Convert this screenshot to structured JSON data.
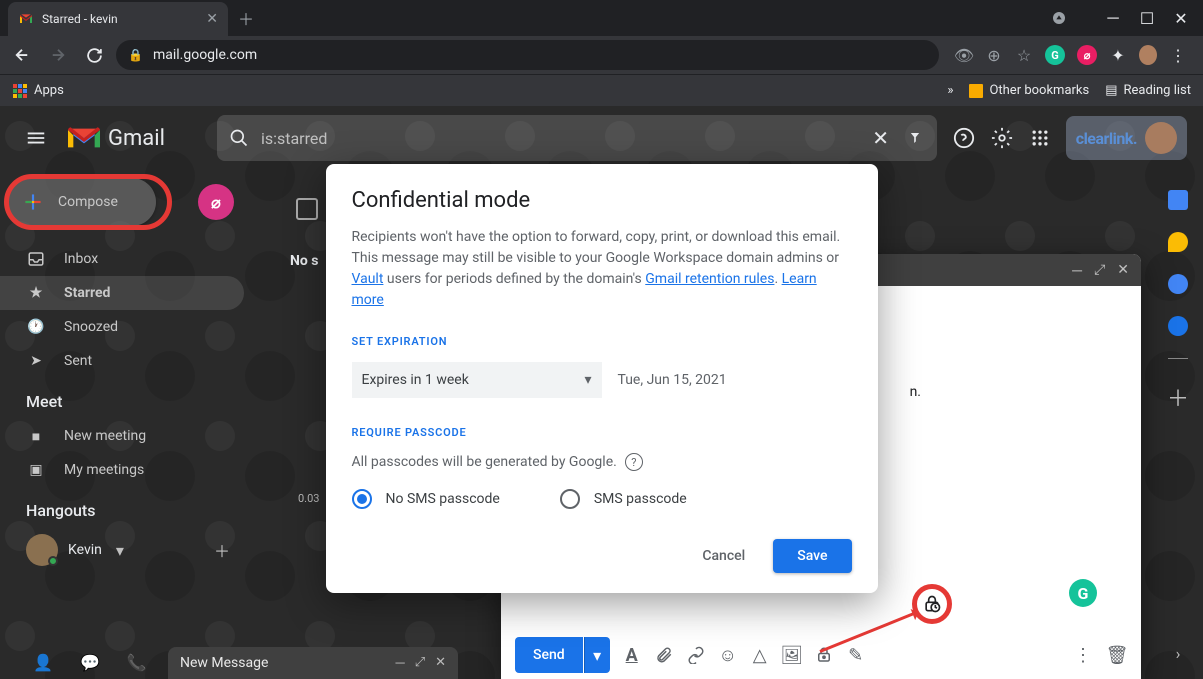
{
  "browser": {
    "tab_title": "Starred - kevin",
    "url": "mail.google.com",
    "bookmarks": {
      "apps": "Apps",
      "other": "Other bookmarks",
      "reading": "Reading list"
    }
  },
  "gmail": {
    "brand": "Gmail",
    "search_value": "is:starred",
    "org": "clearlink.",
    "compose": "Compose",
    "sidebar": {
      "inbox": "Inbox",
      "starred": "Starred",
      "snoozed": "Snoozed",
      "sent": "Sent"
    },
    "meet": {
      "header": "Meet",
      "new": "New meeting",
      "my": "My meetings"
    },
    "hangouts": {
      "header": "Hangouts",
      "user": "Kevin"
    },
    "chat_dock": "New Message",
    "truncated_label": "No s",
    "tiny_number": "0.03"
  },
  "compose_window": {
    "send": "Send",
    "body_hint": "n."
  },
  "modal": {
    "title": "Confidential mode",
    "desc_1": "Recipients won't have the option to forward, copy, print, or download this email. This message may still be visible to your Google Workspace domain admins or ",
    "link_vault": "Vault",
    "desc_2": " users for periods defined by the domain's ",
    "link_retention": "Gmail retention rules",
    "desc_3": ". ",
    "link_learn": "Learn more",
    "set_expiration": "SET EXPIRATION",
    "exp_select": "Expires in 1 week",
    "exp_date": "Tue, Jun 15, 2021",
    "require_passcode": "REQUIRE PASSCODE",
    "passcode_desc": "All passcodes will be generated by Google.",
    "radio_no_sms": "No SMS passcode",
    "radio_sms": "SMS passcode",
    "cancel": "Cancel",
    "save": "Save"
  }
}
